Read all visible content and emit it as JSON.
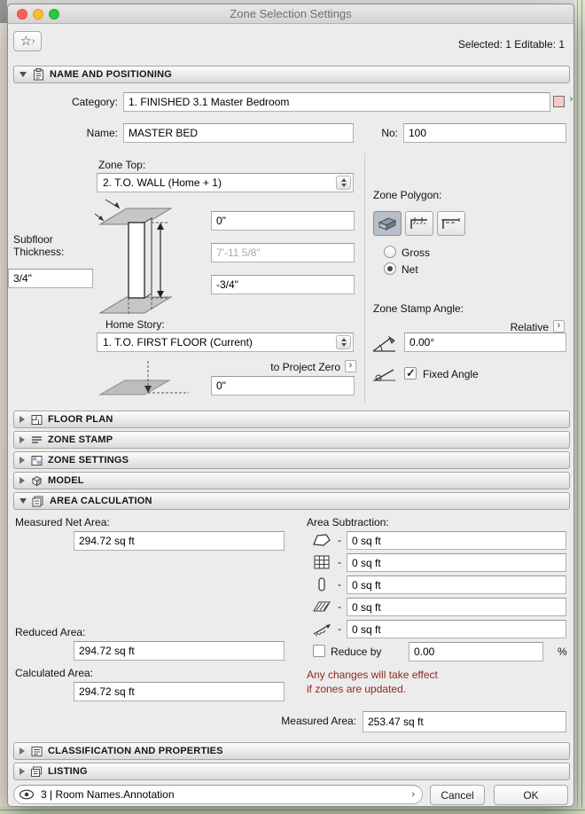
{
  "ui": {
    "chevron": "›"
  },
  "window": {
    "title": "Zone Selection Settings",
    "selected_info": "Selected: 1 Editable: 1",
    "star": "☆"
  },
  "sections": {
    "name_positioning": "NAME AND POSITIONING",
    "floor_plan": "FLOOR PLAN",
    "zone_stamp": "ZONE STAMP",
    "zone_settings": "ZONE SETTINGS",
    "model": "MODEL",
    "area_calculation": "AREA CALCULATION",
    "classification": "CLASSIFICATION AND PROPERTIES",
    "listing": "LISTING"
  },
  "nap": {
    "category_label": "Category:",
    "category_value": "1. FINISHED 3.1 Master Bedroom",
    "name_label": "Name:",
    "name_value": "MASTER BED",
    "no_label": "No:",
    "no_value": "100",
    "zone_top_label": "Zone Top:",
    "zone_top_value": "2. T.O. WALL (Home + 1)",
    "top_offset": "0\"",
    "wall_height": "7'-11 5/8\"",
    "bottom_offset": "-3/4\"",
    "subfloor_label_1": "Subfloor",
    "subfloor_label_2": "Thickness:",
    "subfloor_value": "3/4\"",
    "home_story_label": "Home Story:",
    "home_story_value": "1. T.O. FIRST FLOOR (Current)",
    "to_project_zero_label": "to Project Zero",
    "project_zero_value": "0\"",
    "zone_polygon_label": "Zone Polygon:",
    "gross_label": "Gross",
    "net_label": "Net",
    "zone_stamp_angle_label": "Zone Stamp Angle:",
    "relative_label": "Relative",
    "angle_value": "0.00°",
    "fixed_angle_label": "Fixed Angle"
  },
  "area": {
    "measured_net_label": "Measured Net Area:",
    "measured_net_value": "294.72 sq ft",
    "area_subtraction_label": "Area Subtraction:",
    "minus": "-",
    "sub_values": [
      "0 sq ft",
      "0 sq ft",
      "0 sq ft",
      "0 sq ft",
      "0 sq ft"
    ],
    "reduced_label": "Reduced Area:",
    "reduced_value": "294.72 sq ft",
    "reduce_by_label": "Reduce by",
    "reduce_by_value": "0.00",
    "percent": "%",
    "calculated_label": "Calculated Area:",
    "calculated_value": "294.72 sq ft",
    "note_line1": "Any changes will take effect",
    "note_line2": "if zones are updated.",
    "measured_area_label": "Measured Area:",
    "measured_area_value": "253.47 sq ft"
  },
  "footer": {
    "layer_value": "3 | Room Names.Annotation",
    "cancel_label": "Cancel",
    "ok_label": "OK"
  }
}
